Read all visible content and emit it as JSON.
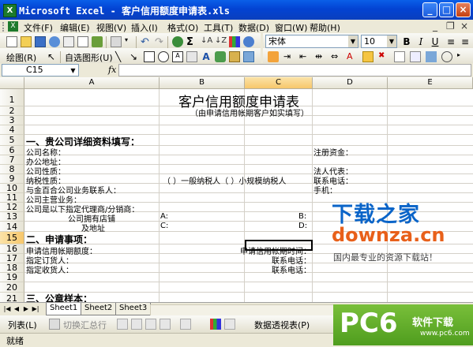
{
  "window": {
    "title": "Microsoft Excel - 客户信用额度申请表.xls",
    "app_icon": "X",
    "min": "_",
    "max": "□",
    "close": "×"
  },
  "menu": {
    "items": [
      "文件(F)",
      "编辑(E)",
      "视图(V)",
      "插入(I)",
      "格式(O)",
      "工具(T)",
      "数据(D)",
      "窗口(W)",
      "帮助(H)"
    ],
    "min": "_",
    "restore": "❐",
    "close": "×"
  },
  "toolbar_std": {
    "font_name": "宋体",
    "font_size": "10",
    "bold": "B",
    "italic": "I",
    "underline": "U",
    "sigma": "Σ"
  },
  "toolbar_draw": {
    "draw_label": "绘图(R)",
    "autoshape_label": "自选图形(U)"
  },
  "formula_bar": {
    "name_box": "C15",
    "fx": "fx",
    "formula": ""
  },
  "columns": [
    "A",
    "B",
    "C",
    "D",
    "E"
  ],
  "rows": [
    "1",
    "2",
    "3",
    "4",
    "5",
    "6",
    "7",
    "8",
    "9",
    "10",
    "11",
    "12",
    "13",
    "14",
    "15",
    "16",
    "17",
    "18",
    "19",
    "20",
    "21"
  ],
  "cells": {
    "r1_title": "客户信用额度申请表",
    "r2_sub": "（由申请信用帐期客户如实填写）",
    "r5_section": "一、贵公司详细资料填写：",
    "r6_a": "公司名称：",
    "r6_d": "注册资金：",
    "r7_a": "办公地址：",
    "r8_a": "公司性质：",
    "r8_d": "法人代表：",
    "r9_a": "纳税性质：",
    "r9_bc": "（    ）一般纳税人（    ）小规模纳税人",
    "r9_d": "联系电话：",
    "r10_a": "与金百合公司业务联系人：",
    "r10_d": "手机：",
    "r11_a": "公司主营业务：",
    "r12_a": "公司是以下指定代理商/分销商：",
    "r13_a": "公司拥有店铺",
    "r13_b": "A:",
    "r13_d": "B:",
    "r14_a": "及地址",
    "r14_b": "C:",
    "r14_d": "D:",
    "r16_section": "二、申请事项：",
    "r17_a": "申请信用帐期额度：",
    "r17_c": "申请信用帐期时间：",
    "r18_a": "指定订货人：",
    "r18_c": "联系电话：",
    "r19_a": "指定收货人：",
    "r19_c": "联系电话：",
    "r21_section": "三、公章样本："
  },
  "watermark": {
    "cn": "下载之家",
    "en": "downza.cn",
    "slogan": "国内最专业的资源下载站！"
  },
  "sheets": [
    "Sheet1",
    "Sheet2",
    "Sheet3"
  ],
  "bottom_toolbar": {
    "list_label": "列表(L)",
    "convert_label": "切换汇总行",
    "pivot_label": "数据透视表(P)"
  },
  "status": {
    "text": "就绪"
  },
  "pc6": {
    "logo": "PC6",
    "label": "软件下载",
    "url": "www.pc6.com"
  },
  "colors": {
    "title_blue": "#0343d3",
    "excel_green": "#1d7a2c",
    "selected_header": "#f7c76b"
  }
}
